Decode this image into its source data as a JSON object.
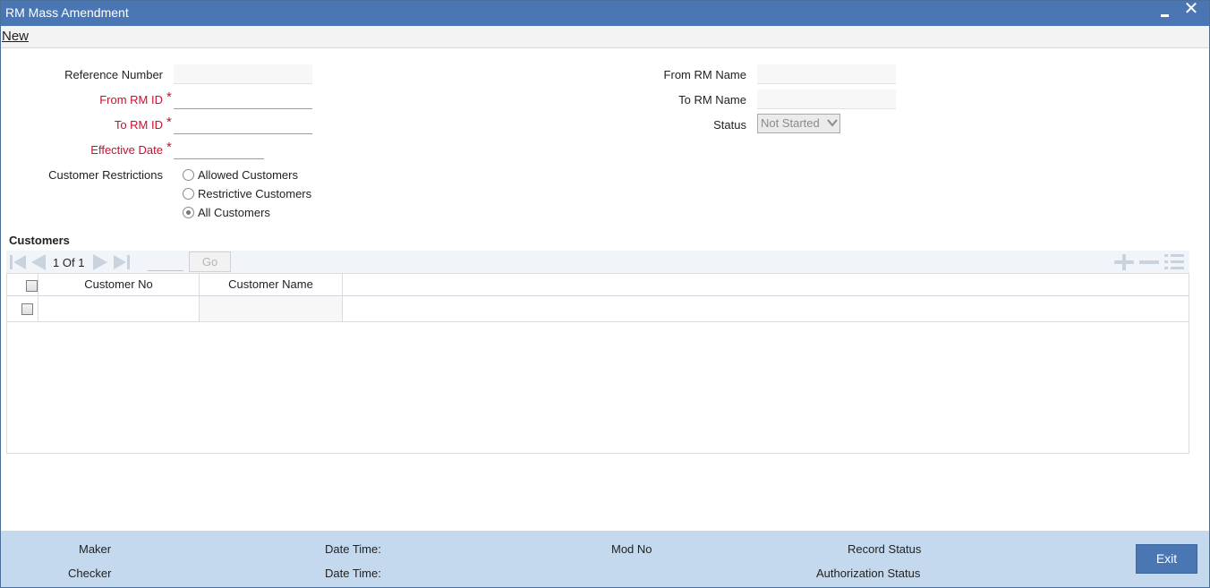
{
  "window": {
    "title": "RM Mass Amendment",
    "close_glyph": "✕"
  },
  "menu": {
    "new_label": "New"
  },
  "form": {
    "reference_number_label": "Reference Number",
    "reference_number_value": "",
    "from_rm_id_label": "From RM ID",
    "from_rm_id_value": "",
    "to_rm_id_label": "To RM ID",
    "to_rm_id_value": "",
    "effective_date_label": "Effective Date",
    "effective_date_value": "",
    "required_marker": "*",
    "customer_restrictions_label": "Customer Restrictions",
    "restriction_options": [
      "Allowed Customers",
      "Restrictive Customers",
      "All Customers"
    ],
    "restriction_selected": "All Customers",
    "from_rm_name_label": "From RM Name",
    "from_rm_name_value": "",
    "to_rm_name_label": "To RM Name",
    "to_rm_name_value": "",
    "status_label": "Status",
    "status_value": "Not Started"
  },
  "customers": {
    "section_title": "Customers",
    "pager": {
      "current": "1",
      "of_label": "Of",
      "total": "1",
      "go_label": "Go"
    },
    "columns": [
      "Customer No",
      "Customer Name"
    ],
    "rows": [
      {
        "customer_no": "",
        "customer_name": ""
      }
    ]
  },
  "footer": {
    "maker_label": "Maker",
    "checker_label": "Checker",
    "date_time_label": "Date Time:",
    "mod_no_label": "Mod No",
    "record_status_label": "Record Status",
    "authorization_status_label": "Authorization Status",
    "exit_label": "Exit"
  },
  "colors": {
    "titlebar": "#4a77b4",
    "required": "#c8102e",
    "footer": "#c4d9ee",
    "exit_button": "#4a77b4"
  }
}
